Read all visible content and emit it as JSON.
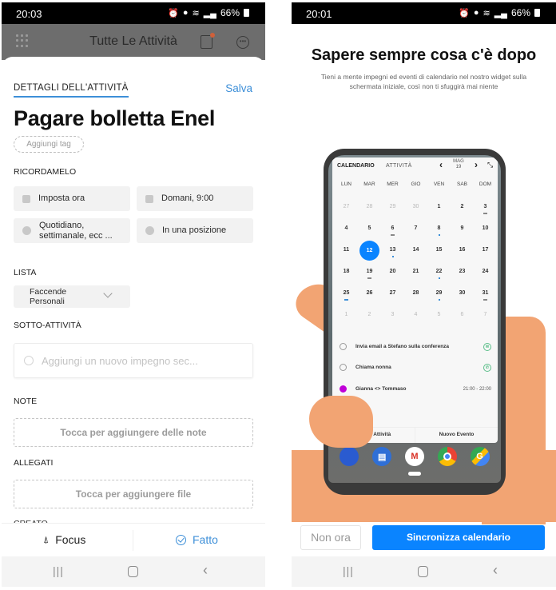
{
  "left_screen": {
    "status_bar": {
      "time": "20:03",
      "battery": "66%"
    },
    "app_header": {
      "title": "Tutte Le Attività"
    },
    "details_tab": "DETTAGLI DELL'ATTIVITÀ",
    "save_label": "Salva",
    "task_title": "Pagare bolletta Enel",
    "add_tag": "Aggiungi tag",
    "remind_label": "RICORDAMELO",
    "remind_options": [
      {
        "icon": "calendar-icon",
        "label": "Imposta ora"
      },
      {
        "icon": "cup-icon",
        "label": "Domani, 9:00"
      },
      {
        "icon": "repeat-icon",
        "label": "Quotidiano, settimanale, ecc ..."
      },
      {
        "icon": "location-icon",
        "label": "In una posizione"
      }
    ],
    "list_label": "LISTA",
    "list_value": "Faccende Personali",
    "subtasks_label": "SOTTO-ATTIVITÀ",
    "subtask_placeholder": "Aggiungi un nuovo impegno sec...",
    "notes_label": "NOTE",
    "notes_placeholder": "Tocca per aggiungere delle note",
    "attachments_label": "ALLEGATI",
    "attachments_placeholder": "Tocca per aggiungere file",
    "created_label": "CREATO",
    "focus_label": "Focus",
    "done_label": "Fatto"
  },
  "right_screen": {
    "status_bar": {
      "time": "20:01",
      "battery": "66%"
    },
    "title": "Sapere sempre cosa c'è dopo",
    "subtitle": "Tieni a mente impegni ed eventi di calendario nel nostro widget sulla schermata iniziale, così non ti sfuggirà mai niente",
    "widget": {
      "tab_calendar": "CALENDARIO",
      "tab_tasks": "ATTIVITÀ",
      "month": "MAG",
      "year": "19",
      "weekdays": [
        "LUN",
        "MAR",
        "MER",
        "GIO",
        "VEN",
        "SAB",
        "DOM"
      ],
      "weeks": [
        [
          "27",
          "28",
          "29",
          "30",
          "1",
          "2",
          "3"
        ],
        [
          "4",
          "5",
          "6",
          "7",
          "8",
          "9",
          "10"
        ],
        [
          "11",
          "12",
          "13",
          "14",
          "15",
          "16",
          "17"
        ],
        [
          "18",
          "19",
          "20",
          "21",
          "22",
          "23",
          "24"
        ],
        [
          "25",
          "26",
          "27",
          "28",
          "29",
          "30",
          "31"
        ],
        [
          "1",
          "2",
          "3",
          "4",
          "5",
          "6",
          "7"
        ]
      ],
      "selected_day": "12",
      "tasks": [
        {
          "label": "Invia email a Stefano sulla conferenza",
          "trailing_icon": "email-icon"
        },
        {
          "label": "Chiama nonna",
          "trailing_icon": "phone-icon"
        },
        {
          "label": "Gianna <> Tommaso",
          "time": "21:00 - 22:00",
          "event_color": "#c000d8"
        }
      ],
      "new_task": "Nuova Attività",
      "new_event": "Nuovo Evento"
    },
    "not_now_label": "Non ora",
    "sync_label": "Sincronizza calendario"
  },
  "colors": {
    "accent_blue": "#3d8fd8",
    "primary_button": "#0a84ff",
    "hand": "#f2a473",
    "event_purple": "#c000d8"
  }
}
